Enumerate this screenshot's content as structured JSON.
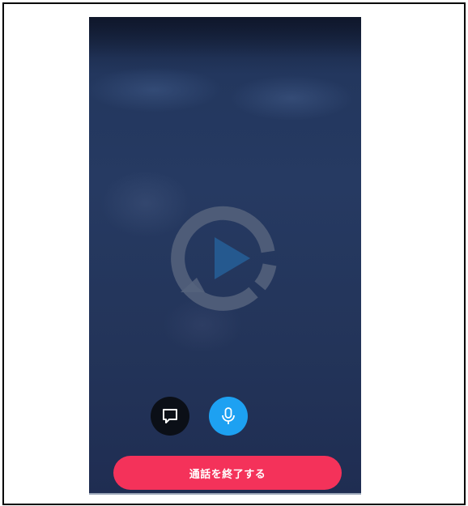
{
  "call_screen": {
    "end_call_label": "通話を終了する",
    "icons": {
      "chat": "chat-bubble-icon",
      "mic": "microphone-icon",
      "logo": "play-logo-icon"
    },
    "colors": {
      "background": "#263a62",
      "end_call": "#f4325a",
      "mic_button": "#1da1f2",
      "chat_button": "#0b0f17"
    }
  }
}
